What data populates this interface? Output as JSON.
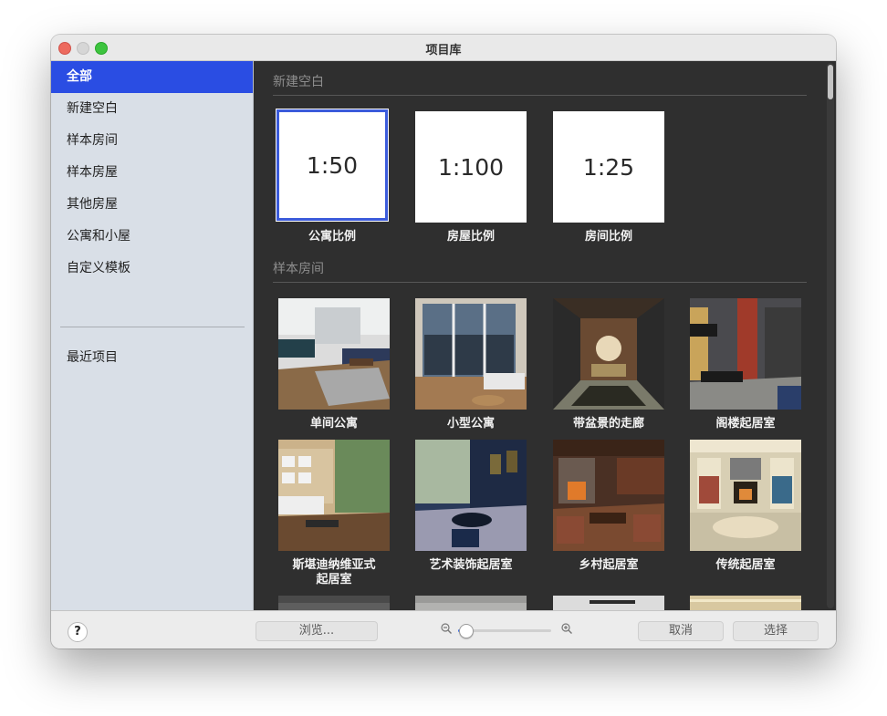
{
  "window": {
    "title": "项目库"
  },
  "sidebar": {
    "items": [
      {
        "label": "全部",
        "active": true
      },
      {
        "label": "新建空白"
      },
      {
        "label": "样本房间"
      },
      {
        "label": "样本房屋"
      },
      {
        "label": "其他房屋"
      },
      {
        "label": "公寓和小屋"
      },
      {
        "label": "自定义模板"
      }
    ],
    "recent": "最近项目"
  },
  "content": {
    "sections": [
      {
        "title": "新建空白"
      },
      {
        "title": "样本房间"
      }
    ],
    "blank_tiles": [
      {
        "scale": "1:50",
        "label": "公寓比例",
        "selected": true
      },
      {
        "scale": "1:100",
        "label": "房屋比例"
      },
      {
        "scale": "1:25",
        "label": "房间比例"
      }
    ],
    "room_tiles": [
      {
        "label": "单间公寓"
      },
      {
        "label": "小型公寓"
      },
      {
        "label": "带盆景的走廊"
      },
      {
        "label": "阁楼起居室"
      },
      {
        "label": "斯堪迪纳维亚式\n起居室"
      },
      {
        "label": "艺术装饰起居室"
      },
      {
        "label": "乡村起居室"
      },
      {
        "label": "传统起居室"
      }
    ]
  },
  "bottom": {
    "help": "?",
    "browse": "浏览...",
    "cancel": "取消",
    "choose": "选择",
    "zoom_value": 0.08
  },
  "icons": [
    "zoom-out-icon",
    "zoom-in-icon",
    "help-icon"
  ]
}
